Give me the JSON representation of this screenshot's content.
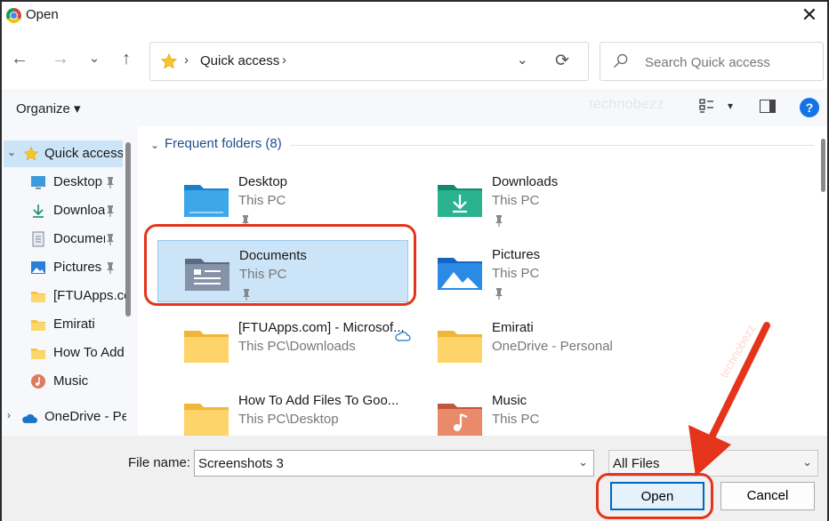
{
  "window": {
    "title": "Open",
    "close_glyph": "✕"
  },
  "nav": {
    "back_glyph": "←",
    "forward_glyph": "→",
    "recent_glyph": "⌄",
    "up_glyph": "↑",
    "address": {
      "location": "Quick access",
      "sep": "›",
      "dropdown_glyph": "⌄",
      "refresh_glyph": "⟳"
    },
    "search": {
      "placeholder": "Search Quick access"
    }
  },
  "toolbar": {
    "organize_label": "Organize ▾",
    "watermark": "technobezz",
    "view_dd_glyph": "▾",
    "help_glyph": "?"
  },
  "sidebar": {
    "items": [
      {
        "label": "Quick access",
        "icon": "star-icon",
        "chevron": "⌄",
        "selected": true
      },
      {
        "label": "Desktop",
        "icon": "desktop-icon",
        "pinned": true
      },
      {
        "label": "Downloads",
        "icon": "download-icon",
        "pinned": true
      },
      {
        "label": "Documents",
        "icon": "document-icon",
        "pinned": true
      },
      {
        "label": "Pictures",
        "icon": "pictures-icon",
        "pinned": true
      },
      {
        "label": "[FTUApps.com] - Microsoft",
        "icon": "folder-icon"
      },
      {
        "label": "Emirati",
        "icon": "folder-icon"
      },
      {
        "label": "How To Add Files To Google",
        "icon": "folder-icon"
      },
      {
        "label": "Music",
        "icon": "music-icon"
      },
      {
        "label": "OneDrive - Personal",
        "icon": "onedrive-icon",
        "chevron": "›"
      }
    ]
  },
  "content": {
    "group_chevron": "⌄",
    "group_title": "Frequent folders (8)",
    "folders": [
      {
        "name": "Desktop",
        "location": "This PC",
        "pinned": true,
        "icon": "desktop-folder-icon"
      },
      {
        "name": "Downloads",
        "location": "This PC",
        "pinned": true,
        "icon": "downloads-folder-icon"
      },
      {
        "name": "Documents",
        "location": "This PC",
        "pinned": true,
        "selected": true,
        "icon": "documents-folder-icon"
      },
      {
        "name": "Pictures",
        "location": "This PC",
        "pinned": true,
        "icon": "pictures-folder-icon"
      },
      {
        "name": "[FTUApps.com] - Microsof...",
        "location": "This PC\\Downloads",
        "icon": "folder-icon"
      },
      {
        "name": "Emirati",
        "location": "OneDrive - Personal",
        "cloud": true,
        "icon": "folder-icon"
      },
      {
        "name": "How To Add Files To Goo...",
        "location": "This PC\\Desktop",
        "icon": "folder-icon"
      },
      {
        "name": "Music",
        "location": "This PC",
        "icon": "music-folder-icon"
      }
    ]
  },
  "footer": {
    "filename_label": "File name:",
    "filename_value": "Screenshots 3",
    "filetype_value": "All Files",
    "dd_glyph": "⌄",
    "open_label": "Open",
    "cancel_label": "Cancel"
  },
  "annotation": {
    "color": "#e4351c",
    "watermark": "technobezz"
  },
  "colors": {
    "selection": "#cce4f7",
    "accent": "#0067c0",
    "link": "#1f4e8c"
  }
}
